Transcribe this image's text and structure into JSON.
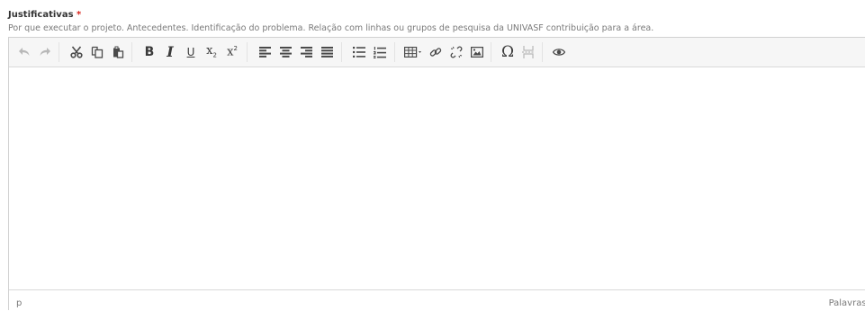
{
  "field": {
    "label": "Justificativas",
    "required_marker": "*",
    "help_text": "Por que executar o projeto. Antecedentes. Identificação do problema. Relação com linhas ou grupos de pesquisa da UNIVASF contribuição para a área."
  },
  "toolbar": {
    "buttons": [
      {
        "icon": "undo-icon"
      },
      {
        "icon": "redo-icon"
      },
      {
        "icon": "cut-icon"
      },
      {
        "icon": "copy-icon"
      },
      {
        "icon": "paste-icon"
      },
      {
        "icon": "bold-icon",
        "glyph": "B"
      },
      {
        "icon": "italic-icon",
        "glyph": "I"
      },
      {
        "icon": "underline-icon",
        "glyph": "U"
      },
      {
        "icon": "subscript-icon",
        "glyph": "x"
      },
      {
        "icon": "superscript-icon",
        "glyph": "x"
      },
      {
        "icon": "align-left-icon"
      },
      {
        "icon": "align-center-icon"
      },
      {
        "icon": "align-right-icon"
      },
      {
        "icon": "align-justify-icon"
      },
      {
        "icon": "bullet-list-icon"
      },
      {
        "icon": "numbered-list-icon"
      },
      {
        "icon": "table-icon"
      },
      {
        "icon": "link-icon"
      },
      {
        "icon": "unlink-icon"
      },
      {
        "icon": "image-icon"
      },
      {
        "icon": "special-char-icon",
        "glyph": "Ω"
      },
      {
        "icon": "page-break-icon"
      },
      {
        "icon": "preview-icon"
      }
    ]
  },
  "statusbar": {
    "path": "p",
    "word_count_label": "Palavras: ("
  },
  "colors": {
    "required": "#d9241c",
    "toolbar_bg": "#f6f6f6",
    "border": "#d1d1d1"
  }
}
